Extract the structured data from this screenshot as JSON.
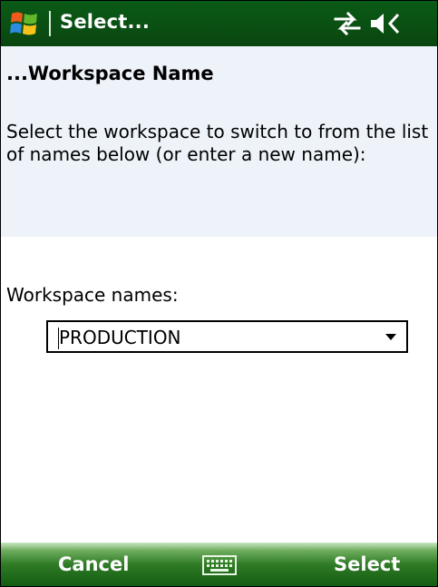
{
  "titlebar": {
    "title": "Select...",
    "start_icon": "windows-start-icon",
    "connectivity_icon": "connectivity-arrows-icon",
    "volume_icon": "speaker-volume-icon"
  },
  "header": {
    "title": "...Workspace Name",
    "instructions": "Select the workspace to switch to from the list of names below (or enter a new name):"
  },
  "form": {
    "label": "Workspace names:",
    "selected_value": "PRODUCTION"
  },
  "softkeys": {
    "left_label": "Cancel",
    "right_label": "Select",
    "center_icon": "keyboard-icon"
  },
  "colors": {
    "titlebar": "#0a4f13",
    "header_band": "#eef3fa",
    "softkey_bar": "#2f7b25"
  }
}
